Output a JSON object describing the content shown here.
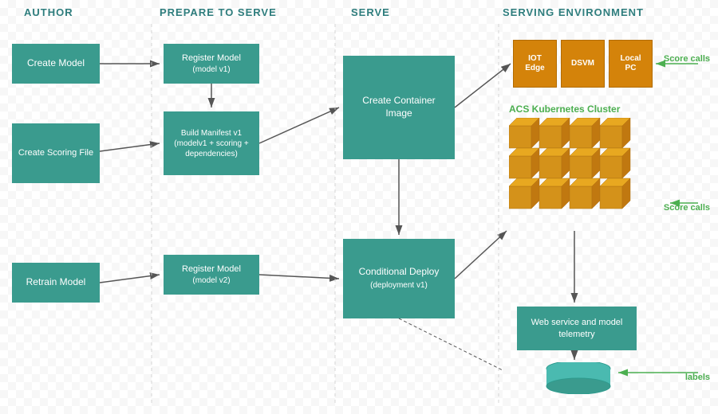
{
  "headers": {
    "author": "AUTHOR",
    "prepare": "PREPARE TO SERVE",
    "serve": "SERVE",
    "serving": "SERVING ENVIRONMENT"
  },
  "boxes": {
    "createModel": "Create Model",
    "createScoringFile": "Create Scoring File",
    "registerModelV1": "Register Model\n(model v1)",
    "buildManifest": "Build Manifest v1\n(modelv1 + scoring +\ndependencies)",
    "retrainModel": "Retrain Model",
    "registerModelV2": "Register Model\n(model v2)",
    "createContainerImage": "Create Container\nImage",
    "conditionalDeploy": "Conditional Deploy\n(deployment v1)",
    "webService": "Web service and model\ntelemetry",
    "iotEdge": "IOT\nEdge",
    "dsvm": "DSVM",
    "localPC": "Local\nPC"
  },
  "labels": {
    "scoreCalls1": "Score\ncalls",
    "scoreCalls2": "Score\ncalls",
    "labelsText": "labels",
    "acsCluster": "ACS Kubernetes Cluster"
  },
  "colors": {
    "teal": "#3A9B8E",
    "orange": "#D4830A",
    "green": "#4CAF50",
    "arrowColor": "#555",
    "headerColor": "#2E9B9B"
  }
}
